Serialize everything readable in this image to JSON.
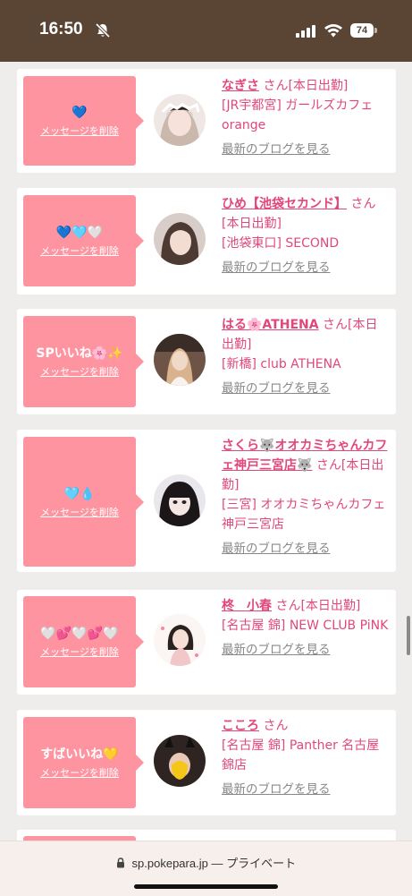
{
  "status": {
    "time": "16:50",
    "battery": "74"
  },
  "cards": [
    {
      "message": "💙",
      "delete_label": "メッセージを削除",
      "name": "なぎさ",
      "san": "さん[本日出勤]",
      "shop": "[JR宇都宮] ガールズカフェorange",
      "blog": "最新のブログを見る",
      "avatar_color": "#d9c9c4"
    },
    {
      "message": "💙🩵🤍",
      "delete_label": "メッセージを削除",
      "name": "ひめ【池袋セカンド】",
      "san": "さん[本日出勤]",
      "shop": "[池袋東口] SECOND",
      "blog": "最新のブログを見る",
      "avatar_color": "#c7bab4"
    },
    {
      "message": "SPいいね🌸✨",
      "delete_label": "メッセージを削除",
      "name": "はる🌸ATHENA",
      "san": "さん[本日出勤]",
      "shop": "[新橋] club ATHENA",
      "blog": "最新のブログを見る",
      "avatar_color": "#8d6e5c"
    },
    {
      "message": "🩵💧",
      "delete_label": "メッセージを削除",
      "name": "さくら🐺オオカミちゃんカフェ神戸三宮店🐺",
      "san": "さん[本日出勤]",
      "shop": "[三宮] オオカミちゃんカフェ神戸三宮店",
      "blog": "最新のブログを見る",
      "avatar_color": "#2c2428"
    },
    {
      "message": "🤍💕🤍💕🤍",
      "delete_label": "メッセージを削除",
      "name": "柊　小春",
      "san": "さん[本日出勤]",
      "shop": "[名古屋 錦] NEW CLUB PiNK",
      "blog": "最新のブログを見る",
      "avatar_color": "#f0e6e1"
    },
    {
      "message": "すばいいね💛",
      "delete_label": "メッセージを削除",
      "name": "こころ",
      "san": "さん",
      "shop": "[名古屋 錦] Panther 名古屋錦店",
      "blog": "最新のブログを見る",
      "avatar_color": "#3b302c"
    }
  ],
  "browser": {
    "domain": "sp.pokepara.jp",
    "mode": "— プライベート"
  }
}
